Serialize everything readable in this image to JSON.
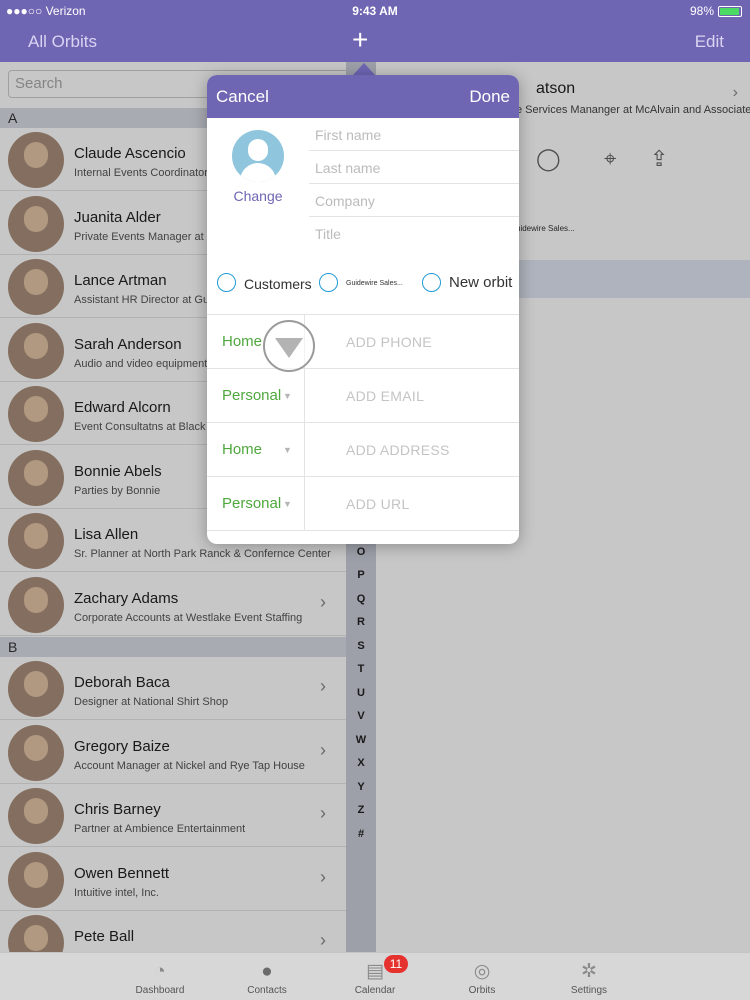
{
  "status": {
    "carrier": "●●●○○ Verizon",
    "time": "9:43 AM",
    "battery": "98%"
  },
  "nav": {
    "left": "All Orbits",
    "plus": "+",
    "right": "Edit"
  },
  "search": {
    "placeholder": "Search"
  },
  "sections": [
    "A",
    "B"
  ],
  "contacts": [
    {
      "name": "Claude Ascencio",
      "sub": "Internal Events Coordinator"
    },
    {
      "name": "Juanita Alder",
      "sub": "Private Events Manager at G"
    },
    {
      "name": "Lance Artman",
      "sub": "Assistant HR Director at Gui"
    },
    {
      "name": "Sarah Anderson",
      "sub": "Audio and video equipment ope"
    },
    {
      "name": "Edward Alcorn",
      "sub": "Event Consultatns at Black T"
    },
    {
      "name": "Bonnie Abels",
      "sub": "Parties by Bonnie"
    },
    {
      "name": "Lisa Allen",
      "sub": "Sr. Planner at North Park Ranck & Confernce Center"
    },
    {
      "name": "Zachary Adams",
      "sub": "Corporate Accounts at Westlake Event Staffing"
    },
    {
      "name": "Deborah Baca",
      "sub": "Designer at National Shirt Shop"
    },
    {
      "name": "Gregory Baize",
      "sub": "Account Manager at Nickel and Rye Tap House"
    },
    {
      "name": "Chris Barney",
      "sub": "Partner at Ambience Entertainment"
    },
    {
      "name": "Owen Bennett",
      "sub": "Intuitive intel, Inc."
    },
    {
      "name": "Pete Ball",
      "sub": ""
    }
  ],
  "index_letters": [
    "O",
    "P",
    "Q",
    "R",
    "S",
    "T",
    "U",
    "V",
    "W",
    "X",
    "Y",
    "Z",
    "#"
  ],
  "detail": {
    "name": "atson",
    "subtitle": "e Services Mananger at McAlvain and Associates",
    "small": "uidewire Sales..."
  },
  "popover": {
    "cancel": "Cancel",
    "done": "Done",
    "change": "Change",
    "fields": {
      "first_name": "First name",
      "last_name": "Last name",
      "company": "Company",
      "title": "Title"
    },
    "orbits": [
      {
        "label": "Customers"
      },
      {
        "label": "Guidewire Sales..."
      },
      {
        "label": "New orbit"
      }
    ],
    "contact_rows": [
      {
        "type": "Home",
        "placeholder": "ADD PHONE"
      },
      {
        "type": "Personal",
        "placeholder": "ADD EMAIL"
      },
      {
        "type": "Home",
        "placeholder": "ADD ADDRESS"
      },
      {
        "type": "Personal",
        "placeholder": "ADD URL"
      }
    ]
  },
  "tabs": [
    {
      "label": "Dashboard",
      "icon": "dashboard-icon"
    },
    {
      "label": "Contacts",
      "icon": "contacts-icon"
    },
    {
      "label": "Calendar",
      "icon": "calendar-icon"
    },
    {
      "label": "Orbits",
      "icon": "orbits-icon"
    },
    {
      "label": "Settings",
      "icon": "settings-icon"
    }
  ],
  "badge": "11",
  "colors": {
    "brand": "#6e66b3",
    "green": "#4fa83d",
    "radio": "#1f9bd6",
    "badge": "#e5322f"
  }
}
